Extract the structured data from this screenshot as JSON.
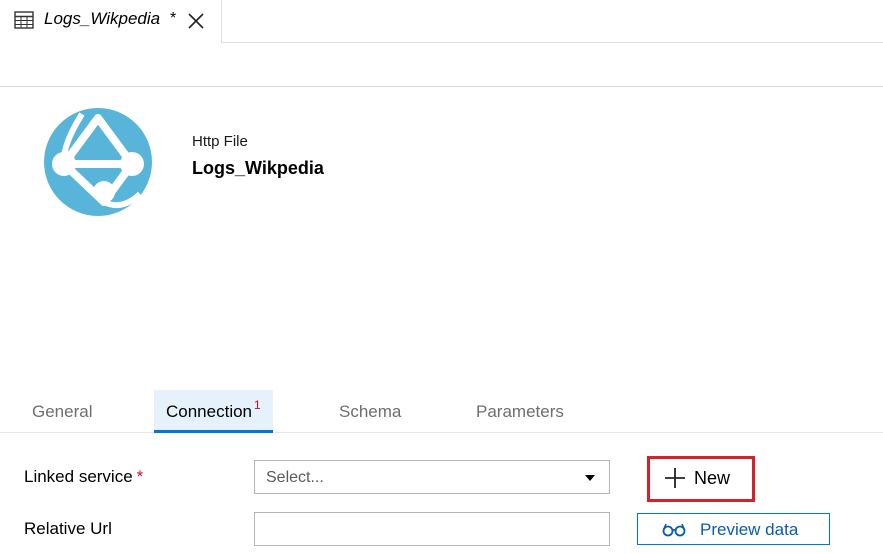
{
  "tab": {
    "title": "Logs_Wikpedia",
    "dirty_marker": "*",
    "icon": "table-icon",
    "close_icon": "close-icon"
  },
  "dataset": {
    "type": "Http File",
    "name": "Logs_Wikpedia",
    "logo_icon": "http-globe-icon",
    "logo_color": "#59b4d9"
  },
  "property_tabs": [
    {
      "label": "General",
      "active": false
    },
    {
      "label": "Connection",
      "active": true,
      "badge": "1"
    },
    {
      "label": "Schema",
      "active": false
    },
    {
      "label": "Parameters",
      "active": false
    }
  ],
  "form": {
    "linked_service": {
      "label": "Linked service",
      "required_marker": "*",
      "placeholder": "Select..."
    },
    "relative_url": {
      "label": "Relative Url",
      "value": ""
    },
    "new_button": {
      "label": "New",
      "icon": "plus-icon",
      "highlight_color": "#d6202a"
    },
    "preview_button": {
      "label": "Preview data",
      "icon": "glasses-icon"
    }
  },
  "colors": {
    "accent": "#0078d4",
    "required": "#c50f1f",
    "active_tab_bg": "#e6f2fb"
  }
}
